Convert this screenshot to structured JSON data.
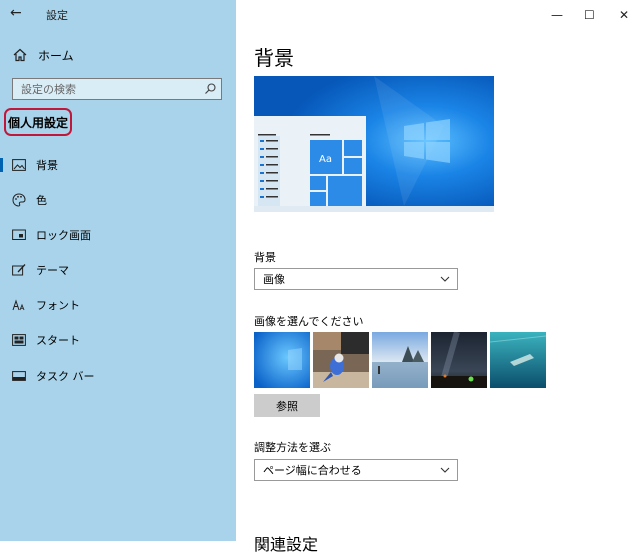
{
  "window": {
    "title": "設定",
    "back_glyph": "←"
  },
  "sidebar": {
    "home_label": "ホーム",
    "search_placeholder": "設定の検索",
    "section_title": "個人用設定",
    "items": [
      {
        "label": "背景",
        "icon": "image-icon",
        "selected": true
      },
      {
        "label": "色",
        "icon": "palette-icon",
        "selected": false
      },
      {
        "label": "ロック画面",
        "icon": "lock-screen-icon",
        "selected": false
      },
      {
        "label": "テーマ",
        "icon": "theme-icon",
        "selected": false
      },
      {
        "label": "フォント",
        "icon": "font-icon",
        "selected": false
      },
      {
        "label": "スタート",
        "icon": "start-icon",
        "selected": false
      },
      {
        "label": "タスク バー",
        "icon": "taskbar-icon",
        "selected": false
      }
    ]
  },
  "window_controls": {
    "minimize": "—",
    "maximize": "☐",
    "close": "✕"
  },
  "main": {
    "title": "背景",
    "preview_sample_text": "Aa",
    "background_label": "背景",
    "background_value": "画像",
    "choose_image_label": "画像を選んでください",
    "browse_label": "参照",
    "fit_label": "調整方法を選ぶ",
    "fit_value": "ページ幅に合わせる",
    "related_heading": "関連設定"
  },
  "colors": {
    "sidebar_bg": "#a9d3ea",
    "accent": "#0063b1",
    "highlight_border": "#c0183b",
    "preview_blue": "#0b6fd4"
  }
}
